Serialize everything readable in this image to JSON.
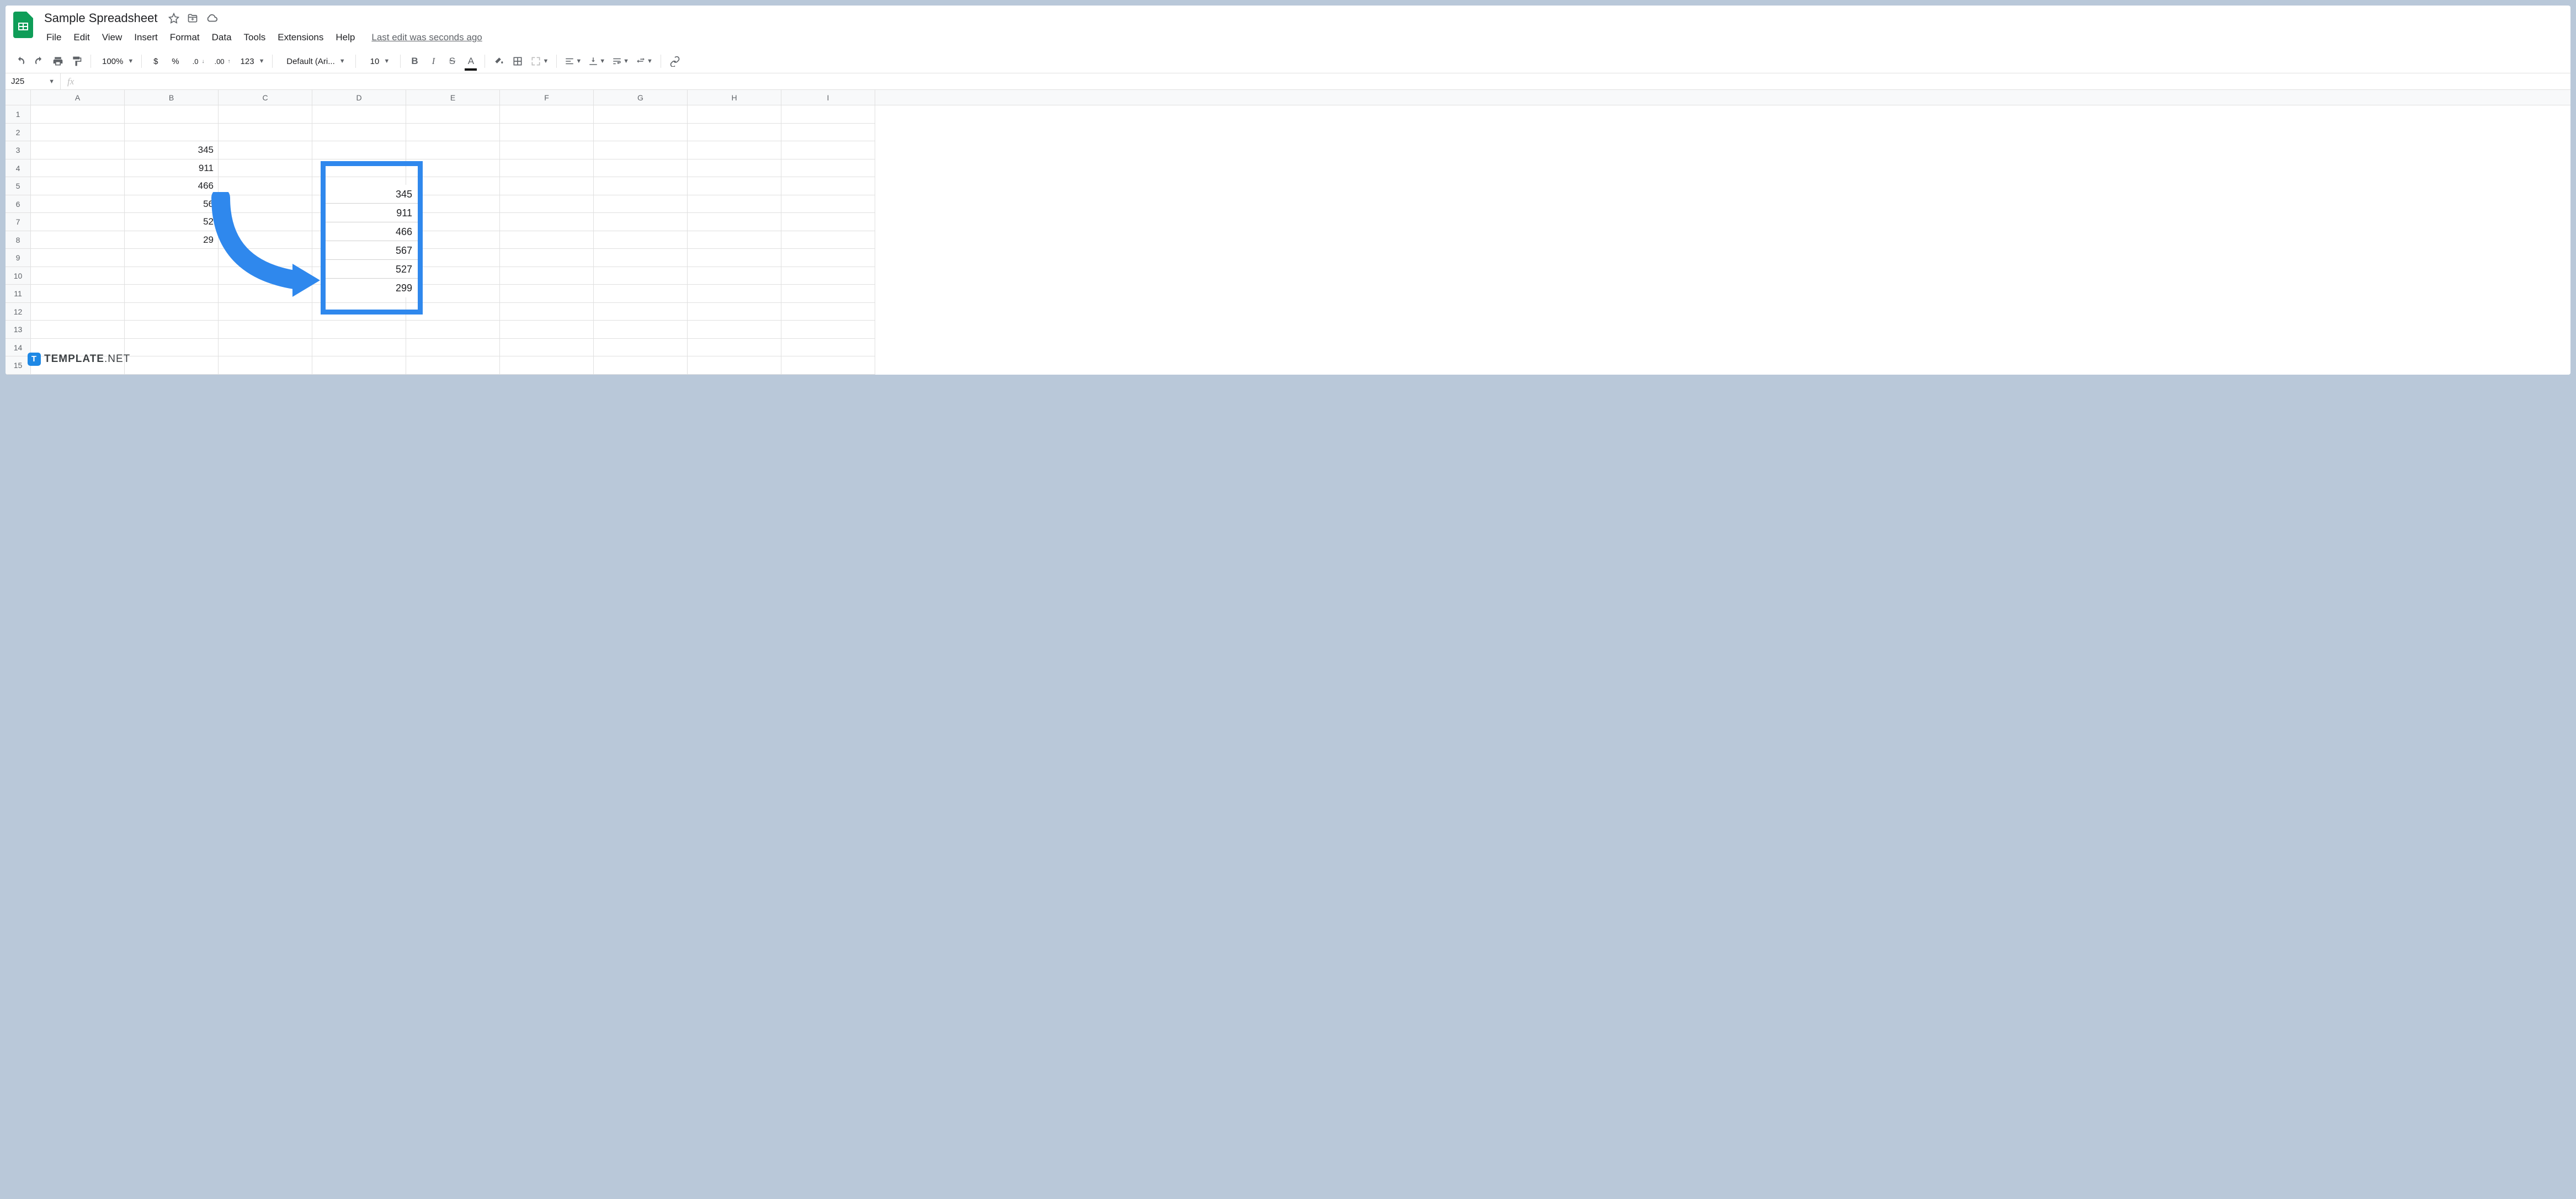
{
  "doc": {
    "title": "Sample Spreadsheet"
  },
  "menu": {
    "file": "File",
    "edit": "Edit",
    "view": "View",
    "insert": "Insert",
    "format": "Format",
    "data": "Data",
    "tools": "Tools",
    "extensions": "Extensions",
    "help": "Help",
    "lastedit": "Last edit was seconds ago"
  },
  "toolbar": {
    "zoom": "100%",
    "currency": "$",
    "percent": "%",
    "dec_dec": ".0",
    "inc_dec": ".00",
    "numfmt": "123",
    "font": "Default (Ari...",
    "fontsize": "10"
  },
  "namebox": "J25",
  "columns": [
    "A",
    "B",
    "C",
    "D",
    "E",
    "F",
    "G",
    "H",
    "I"
  ],
  "rows": [
    "1",
    "2",
    "3",
    "4",
    "5",
    "6",
    "7",
    "8",
    "9",
    "10",
    "11",
    "12",
    "13",
    "14",
    "15"
  ],
  "cells": {
    "B3": "345",
    "B4": "911",
    "B5": "466",
    "B6": "56",
    "B7": "52",
    "B8": "29"
  },
  "overlay_values": [
    "345",
    "911",
    "466",
    "567",
    "527",
    "299"
  ],
  "watermark": {
    "badge": "T",
    "text1": "TEMPLATE",
    "text2": ".NET"
  }
}
